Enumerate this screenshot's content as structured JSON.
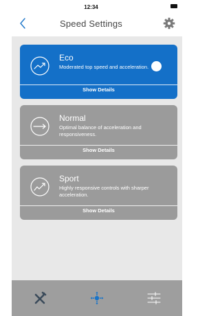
{
  "status_bar": {
    "time": "12:34",
    "battery_icon": "battery-icon"
  },
  "nav": {
    "title": "Speed Settings",
    "back_icon": "chevron-left-icon",
    "settings_icon": "gear-icon",
    "accent_color": "#1a74c8",
    "gear_color": "#7a7a7a"
  },
  "modes": [
    {
      "title": "Eco",
      "description": "Moderated top speed and acceleration.",
      "details_label": "Show Details",
      "icon": "gauge-trending-up-icon",
      "active": true
    },
    {
      "title": "Normal",
      "description": "Optimal balance of acceleration and responsiveness.",
      "details_label": "Show Details",
      "icon": "gauge-arrow-right-icon",
      "active": false
    },
    {
      "title": "Sport",
      "description": "Highly responsive controls with sharper acceleration.",
      "details_label": "Show Details",
      "icon": "gauge-zigzag-up-icon",
      "active": false
    }
  ],
  "colors": {
    "active_card": "#1470c8",
    "inactive_card": "#9b9b9b",
    "content_bg": "#e8e8e8",
    "tab_bar_bg": "#9e9e9e",
    "active_tab_icon": "#1a74c8"
  },
  "tab_bar": {
    "tabs": [
      {
        "icon": "scooter-icon",
        "active": false
      },
      {
        "icon": "speed-mode-icon",
        "active": true
      },
      {
        "icon": "sliders-icon",
        "active": false
      }
    ]
  }
}
